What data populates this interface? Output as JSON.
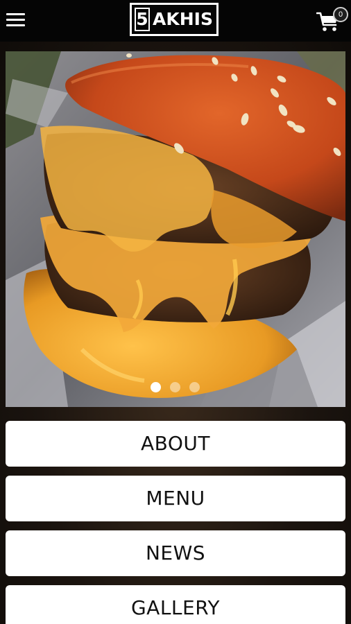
{
  "header": {
    "menu_icon": "hamburger-menu-icon",
    "logo": {
      "number": "5",
      "text": "AKHIS"
    },
    "cart": {
      "icon": "shopping-cart-icon",
      "count": "0"
    }
  },
  "hero": {
    "image": "burger-with-melted-cheese-photo",
    "slides_total": 3,
    "active_slide": 1
  },
  "nav": {
    "items": [
      {
        "label": "ABOUT"
      },
      {
        "label": "MENU"
      },
      {
        "label": "NEWS"
      },
      {
        "label": "GALLERY"
      }
    ]
  }
}
